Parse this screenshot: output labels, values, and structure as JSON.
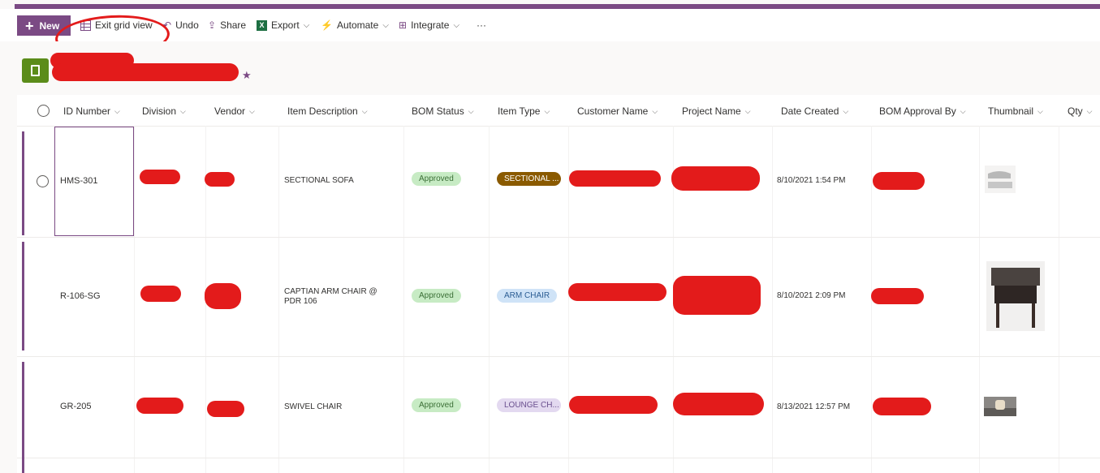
{
  "commandbar": {
    "new_label": "New",
    "exit_grid_label": "Exit grid view",
    "undo_label": "Undo",
    "share_label": "Share",
    "export_label": "Export",
    "automate_label": "Automate",
    "integrate_label": "Integrate",
    "more_label": "···"
  },
  "list": {
    "title": ""
  },
  "columns": [
    "ID Number",
    "Division",
    "Vendor",
    "Item Description",
    "BOM Status",
    "Item Type",
    "Customer Name",
    "Project Name",
    "Date Created",
    "BOM Approval By",
    "Thumbnail",
    "Qty"
  ],
  "rows": [
    {
      "id": "HMS-301",
      "description": "SECTIONAL SOFA",
      "bom_status": "Approved",
      "item_type": "SECTIONAL ...",
      "date_created": "8/10/2021 1:54 PM"
    },
    {
      "id": "R-106-SG",
      "description": "CAPTIAN ARM CHAIR @ PDR 106",
      "bom_status": "Approved",
      "item_type": "ARM CHAIR",
      "date_created": "8/10/2021 2:09 PM"
    },
    {
      "id": "GR-205",
      "description": "SWIVEL CHAIR",
      "bom_status": "Approved",
      "item_type": "LOUNGE CH...",
      "date_created": "8/13/2021 12:57 PM"
    }
  ],
  "colors": {
    "accent": "#7b4a84",
    "approved_bg": "#c7ebc4",
    "sectional_bg": "#8a5a00",
    "armchair_bg": "#cfe3f7",
    "lounge_bg": "#e3d9f0",
    "redaction": "#e31b1b"
  }
}
